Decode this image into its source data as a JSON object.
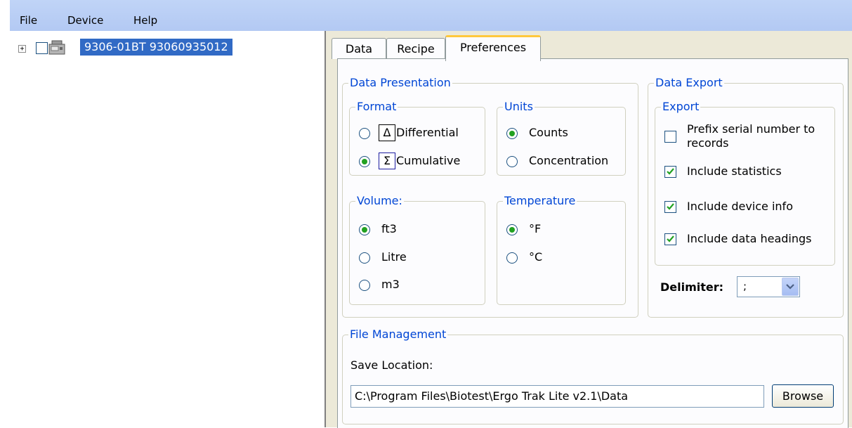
{
  "menu": {
    "file": "File",
    "device": "Device",
    "help": "Help"
  },
  "tree": {
    "expander": "+",
    "node_label": "9306-01BT 93060935012"
  },
  "tabs": {
    "data": "Data",
    "recipe": "Recipe",
    "preferences": "Preferences"
  },
  "data_presentation": {
    "title": "Data Presentation",
    "format": {
      "title": "Format",
      "differential_symbol": "Δ",
      "differential_label": "Differential",
      "cumulative_symbol": "Σ",
      "cumulative_label": "Cumulative",
      "selected": "Cumulative"
    },
    "units": {
      "title": "Units",
      "counts_label": "Counts",
      "concentration_label": "Concentration",
      "selected": "Counts"
    },
    "volume": {
      "title": "Volume:",
      "ft3_label": "ft3",
      "litre_label": "Litre",
      "m3_label": "m3",
      "selected": "ft3"
    },
    "temperature": {
      "title": "Temperature",
      "f_label": "°F",
      "c_label": "°C",
      "selected": "°F"
    }
  },
  "data_export": {
    "title": "Data Export",
    "export": {
      "title": "Export",
      "prefix_label_line1": "Prefix serial number to",
      "prefix_label_line2": "records",
      "prefix_checked": false,
      "statistics_label": "Include statistics",
      "statistics_checked": true,
      "device_info_label": "Include device info",
      "device_info_checked": true,
      "headings_label": "Include data headings",
      "headings_checked": true
    },
    "delimiter_label": "Delimiter:",
    "delimiter_value": ";"
  },
  "file_management": {
    "title": "File Management",
    "save_location_label": "Save Location:",
    "save_location_value": "C:\\Program Files\\Biotest\\Ergo Trak Lite v2.1\\Data",
    "browse_label": "Browse"
  },
  "colors": {
    "menubar": "#b8cdf4",
    "selection": "#316ac5",
    "group_title": "#0046d5",
    "radio_dot": "#21a121",
    "check_mark": "#21a121",
    "panel_bg": "#ece9d8"
  }
}
